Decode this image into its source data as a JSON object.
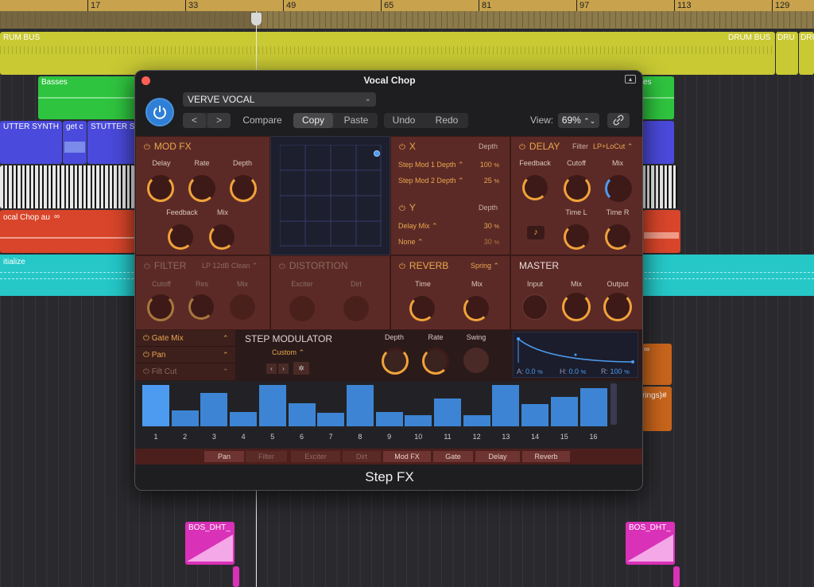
{
  "ruler": {
    "bars": [
      "17",
      "33",
      "49",
      "65",
      "81",
      "97",
      "113",
      "129"
    ]
  },
  "tracks": {
    "drum_bus_left": "RUM BUS",
    "drum_bus_right": "DRUM BUS",
    "dru": "DRU",
    "dru2": "DRU",
    "basses_left": "Basses",
    "basses_right": "ses",
    "stutter_synth": "UTTER SYNTH",
    "get_c": "get c",
    "stutter_s": "STUTTER S",
    "vocal_chop": "ocal Chop au",
    "initialize": "itialize",
    "strings": "rings)#",
    "bos_left": "BOS_DHT_",
    "bos_right": "BOS_DHT_"
  },
  "plugin": {
    "title": "Vocal Chop",
    "preset": "VERVE VOCAL",
    "prev": "<",
    "next": ">",
    "compare": "Compare",
    "copy": "Copy",
    "paste": "Paste",
    "undo": "Undo",
    "redo": "Redo",
    "view_label": "View:",
    "view_value": "69%",
    "link_icon": "link-icon",
    "footer": "Step FX",
    "modfx": {
      "title": "MOD FX",
      "delay": "Delay",
      "rate": "Rate",
      "depth": "Depth",
      "feedback": "Feedback",
      "mix": "Mix"
    },
    "xy": {
      "x_title": "X",
      "x_depth": "Depth",
      "x_rows": [
        {
          "name": "Step Mod 1 Depth",
          "value": "100",
          "unit": "%"
        },
        {
          "name": "Step Mod 2 Depth",
          "value": "25",
          "unit": "%"
        }
      ],
      "y_title": "Y",
      "y_depth": "Depth",
      "y_rows": [
        {
          "name": "Delay Mix",
          "value": "30",
          "unit": "%"
        },
        {
          "name": "None",
          "value": "30",
          "unit": "%"
        }
      ]
    },
    "delay": {
      "title": "DELAY",
      "filter_label": "Filter",
      "filter_value": "LP+LoCut",
      "feedback": "Feedback",
      "cutoff": "Cutoff",
      "mix": "Mix",
      "timel": "Time L",
      "timer": "Time R",
      "note_icon": "note-icon"
    },
    "filter": {
      "title": "FILTER",
      "type": "LP 12dB Clean",
      "cutoff": "Cutoff",
      "res": "Res",
      "mix": "Mix"
    },
    "distortion": {
      "title": "DISTORTION",
      "exciter": "Exciter",
      "dirt": "Dirt"
    },
    "reverb": {
      "title": "REVERB",
      "type": "Spring",
      "time": "Time",
      "mix": "Mix"
    },
    "master": {
      "title": "MASTER",
      "input": "Input",
      "mix": "Mix",
      "output": "Output"
    },
    "stepmod": {
      "targets": [
        "Gate Mix",
        "Pan",
        "Filt Cut"
      ],
      "title": "STEP MODULATOR",
      "mode": "Custom",
      "depth": "Depth",
      "rate": "Rate",
      "swing": "Swing",
      "env_a_label": "A:",
      "env_a": "0.0",
      "env_h_label": "H:",
      "env_h": "0.0",
      "env_r_label": "R:",
      "env_r": "100",
      "env_unit": "%",
      "step_values": [
        1.0,
        0.38,
        0.8,
        0.34,
        1.0,
        0.55,
        0.32,
        1.0,
        0.34,
        0.27,
        0.68,
        0.26,
        1.0,
        0.54,
        0.72,
        0.93
      ],
      "step_labels": [
        "1",
        "2",
        "3",
        "4",
        "5",
        "6",
        "7",
        "8",
        "9",
        "10",
        "11",
        "12",
        "13",
        "14",
        "15",
        "16"
      ]
    },
    "tabs": [
      {
        "label": "Pan",
        "dim": false
      },
      {
        "label": "Filter",
        "dim": true
      },
      {
        "label": "Exciter",
        "dim": true
      },
      {
        "label": "Dirt",
        "dim": true
      },
      {
        "label": "Mod FX",
        "dim": false
      },
      {
        "label": "Gate",
        "dim": false
      },
      {
        "label": "Delay",
        "dim": false
      },
      {
        "label": "Reverb",
        "dim": false
      }
    ]
  },
  "colors": {
    "accent": "#e7a74f",
    "panel": "#5c2a26",
    "step": "#3d85d4",
    "power": "#2f7fd6"
  }
}
